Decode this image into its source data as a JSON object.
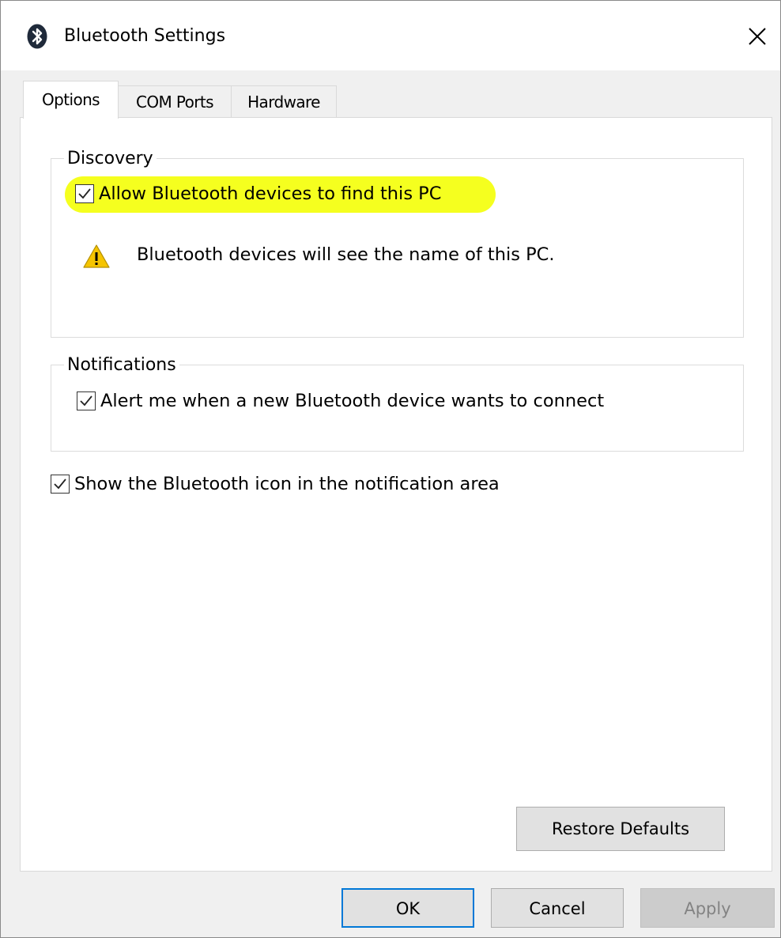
{
  "window": {
    "title": "Bluetooth Settings",
    "icon": "bluetooth-icon",
    "close_glyph": "close-icon"
  },
  "tabs": [
    {
      "label": "Options",
      "selected": true
    },
    {
      "label": "COM Ports",
      "selected": false
    },
    {
      "label": "Hardware",
      "selected": false
    }
  ],
  "discovery": {
    "legend": "Discovery",
    "allow_label": "Allow Bluetooth devices to find this PC",
    "allow_checked": true,
    "warning_text": "Bluetooth devices will see the name of this PC.",
    "warning_icon": "warning-icon",
    "highlight_color": "#f5ff1f"
  },
  "notifications": {
    "legend": "Notifications",
    "alert_label": "Alert me when a new Bluetooth device wants to connect",
    "alert_checked": true
  },
  "show_icon": {
    "label": "Show the Bluetooth icon in the notification area",
    "checked": true
  },
  "buttons": {
    "restore": "Restore Defaults",
    "ok": "OK",
    "cancel": "Cancel",
    "apply": "Apply"
  },
  "colors": {
    "accent": "#0078d7",
    "dialog_bg": "#f0f0f0",
    "panel_bg": "#ffffff",
    "disabled_text": "#838383"
  }
}
